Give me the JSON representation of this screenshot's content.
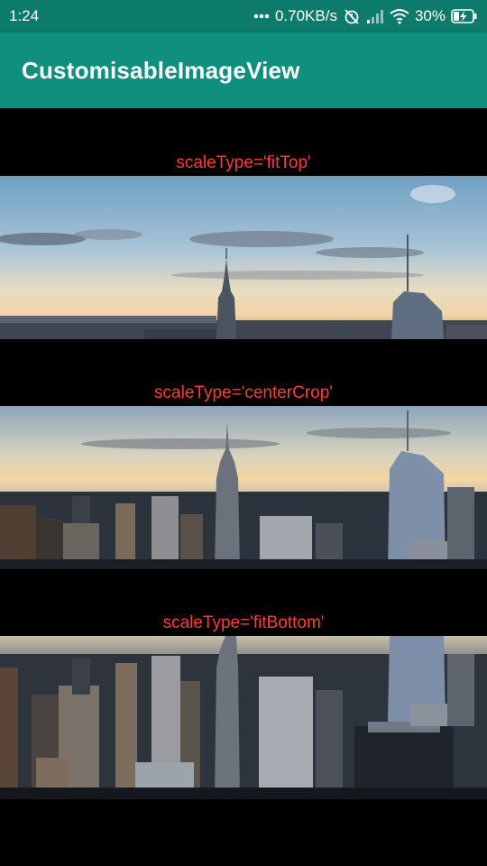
{
  "status_bar": {
    "time": "1:24",
    "network_speed": "0.70KB/s",
    "battery": "30%",
    "icons": [
      "more-dots-icon",
      "alarm-off-icon",
      "signal-icon",
      "wifi-icon",
      "battery-charging-icon"
    ]
  },
  "app_bar": {
    "title": "CustomisableImageView",
    "color": "#118f7d"
  },
  "image_views": [
    {
      "label": "scaleType='fitTop'",
      "crop": "top"
    },
    {
      "label": "scaleType='centerCrop'",
      "crop": "center"
    },
    {
      "label": "scaleType='fitBottom'",
      "crop": "bottom"
    }
  ],
  "colors": {
    "label": "#ff3b3b",
    "status_bar": "#0d7b6b",
    "background": "#000000"
  }
}
